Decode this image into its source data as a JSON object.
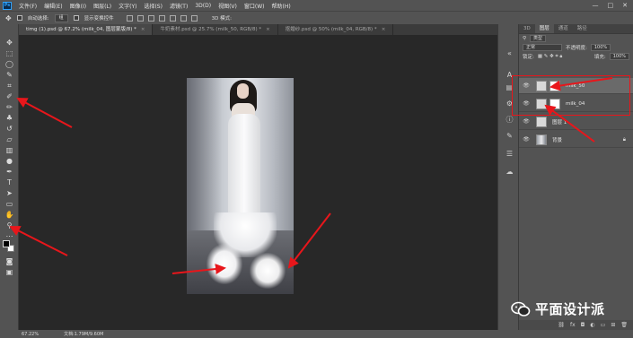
{
  "app": {
    "logo_text": "Ps"
  },
  "menu": [
    "文件(F)",
    "编辑(E)",
    "图像(I)",
    "图层(L)",
    "文字(Y)",
    "选择(S)",
    "滤镜(T)",
    "3D(D)",
    "视图(V)",
    "窗口(W)",
    "帮助(H)"
  ],
  "window_controls": [
    "—",
    "□",
    "✕"
  ],
  "options": {
    "auto_select_label": "自动选择:",
    "auto_select_value": "组",
    "show_transform_label": "显示变换控件",
    "mode_3d_label": "3D 模式:"
  },
  "tabs": [
    {
      "label": "timg (1).psd @ 67.2% (milk_04, 图层蒙版/8) *",
      "close": "×"
    },
    {
      "label": "牛奶素材.psd @ 25.7% (milk_50, RGB/8) *",
      "close": "×"
    },
    {
      "label": "抠婚纱.psd @ 50% (milk_04, RGB/8) *",
      "close": "×"
    }
  ],
  "tools": {
    "foreground_color": "#000000",
    "background_color": "#ffffff"
  },
  "layers_panel": {
    "tabs": [
      "3D",
      "图层",
      "通道",
      "路径"
    ],
    "filter_label": "类型",
    "blend_mode": "正常",
    "opacity_label": "不透明度:",
    "opacity_value": "100%",
    "lock_label": "锁定:",
    "fill_label": "填充:",
    "fill_value": "100%",
    "layers": [
      {
        "name": "milk_50",
        "visible": true,
        "has_mask": true,
        "selected": true
      },
      {
        "name": "milk_04",
        "visible": true,
        "has_mask": true,
        "selected": false
      },
      {
        "name": "图层 1",
        "visible": true,
        "has_mask": false,
        "selected": false
      },
      {
        "name": "背景",
        "visible": true,
        "has_mask": false,
        "selected": false,
        "locked": true
      }
    ]
  },
  "status": {
    "zoom": "67.22%",
    "doc_size": "文档:1.79M/9.60M"
  },
  "annotation_color": "#e8161b",
  "watermark": {
    "text": "平面设计派"
  }
}
